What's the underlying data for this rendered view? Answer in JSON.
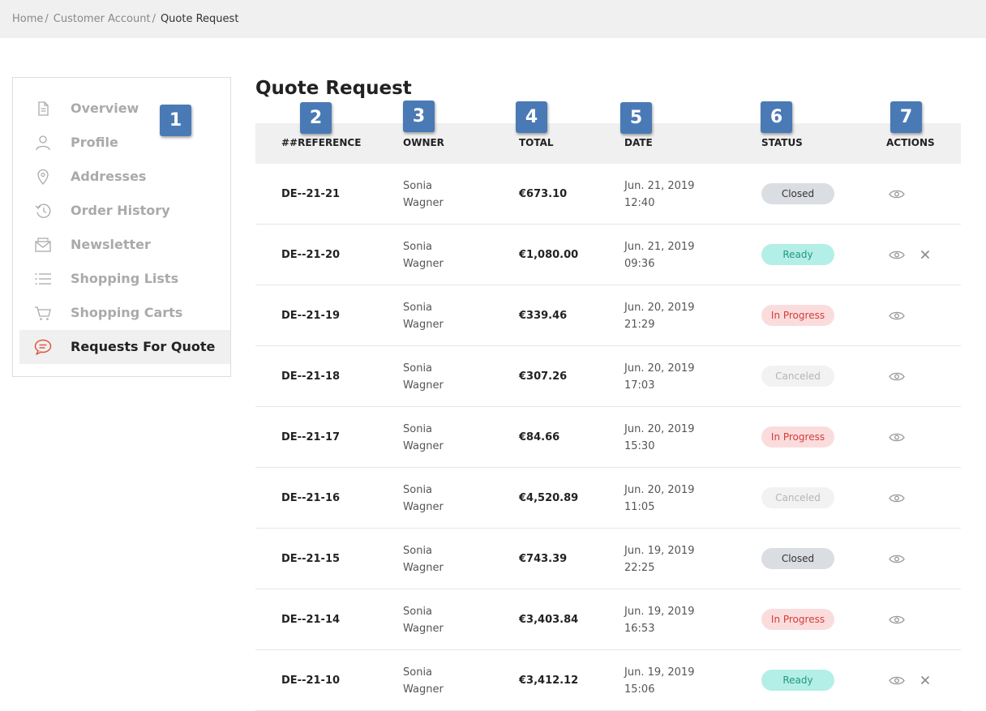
{
  "breadcrumb": [
    {
      "label": "Home"
    },
    {
      "label": "Customer Account"
    },
    {
      "label": "Quote Request"
    }
  ],
  "breadcrumb_separator": "/",
  "sidebar": {
    "items": [
      {
        "label": "Overview",
        "icon": "document-icon"
      },
      {
        "label": "Profile",
        "icon": "user-icon"
      },
      {
        "label": "Addresses",
        "icon": "location-pin-icon"
      },
      {
        "label": "Order History",
        "icon": "history-icon"
      },
      {
        "label": "Newsletter",
        "icon": "envelope-icon"
      },
      {
        "label": "Shopping Lists",
        "icon": "list-icon"
      },
      {
        "label": "Shopping Carts",
        "icon": "cart-icon"
      },
      {
        "label": "Requests For Quote",
        "icon": "chat-bubble-icon",
        "active": true
      }
    ]
  },
  "annotations": [
    "1",
    "2",
    "3",
    "4",
    "5",
    "6",
    "7"
  ],
  "page_title": "Quote Request",
  "table": {
    "columns": [
      "##REFERENCE",
      "OWNER",
      "TOTAL",
      "DATE",
      "STATUS",
      "ACTIONS"
    ],
    "rows": [
      {
        "reference": "DE--21-21",
        "owner_first": "Sonia",
        "owner_last": "Wagner",
        "total": "€673.10",
        "date": "Jun. 21, 2019",
        "time": "12:40",
        "status": "Closed",
        "status_type": "closed",
        "cancelable": false
      },
      {
        "reference": "DE--21-20",
        "owner_first": "Sonia",
        "owner_last": "Wagner",
        "total": "€1,080.00",
        "date": "Jun. 21, 2019",
        "time": "09:36",
        "status": "Ready",
        "status_type": "ready",
        "cancelable": true
      },
      {
        "reference": "DE--21-19",
        "owner_first": "Sonia",
        "owner_last": "Wagner",
        "total": "€339.46",
        "date": "Jun. 20, 2019",
        "time": "21:29",
        "status": "In Progress",
        "status_type": "progress",
        "cancelable": false
      },
      {
        "reference": "DE--21-18",
        "owner_first": "Sonia",
        "owner_last": "Wagner",
        "total": "€307.26",
        "date": "Jun. 20, 2019",
        "time": "17:03",
        "status": "Canceled",
        "status_type": "canceled",
        "cancelable": false
      },
      {
        "reference": "DE--21-17",
        "owner_first": "Sonia",
        "owner_last": "Wagner",
        "total": "€84.66",
        "date": "Jun. 20, 2019",
        "time": "15:30",
        "status": "In Progress",
        "status_type": "progress",
        "cancelable": false
      },
      {
        "reference": "DE--21-16",
        "owner_first": "Sonia",
        "owner_last": "Wagner",
        "total": "€4,520.89",
        "date": "Jun. 20, 2019",
        "time": "11:05",
        "status": "Canceled",
        "status_type": "canceled",
        "cancelable": false
      },
      {
        "reference": "DE--21-15",
        "owner_first": "Sonia",
        "owner_last": "Wagner",
        "total": "€743.39",
        "date": "Jun. 19, 2019",
        "time": "22:25",
        "status": "Closed",
        "status_type": "closed",
        "cancelable": false
      },
      {
        "reference": "DE--21-14",
        "owner_first": "Sonia",
        "owner_last": "Wagner",
        "total": "€3,403.84",
        "date": "Jun. 19, 2019",
        "time": "16:53",
        "status": "In Progress",
        "status_type": "progress",
        "cancelable": false
      },
      {
        "reference": "DE--21-10",
        "owner_first": "Sonia",
        "owner_last": "Wagner",
        "total": "€3,412.12",
        "date": "Jun. 19, 2019",
        "time": "15:06",
        "status": "Ready",
        "status_type": "ready",
        "cancelable": true
      }
    ]
  },
  "colors": {
    "accent": "#e0553d",
    "badge": "#4a7ab5",
    "ready_bg": "#b3efe6",
    "progress_bg": "#fbdcdc",
    "closed_bg": "#dadde2",
    "canceled_bg": "#f2f2f2"
  }
}
